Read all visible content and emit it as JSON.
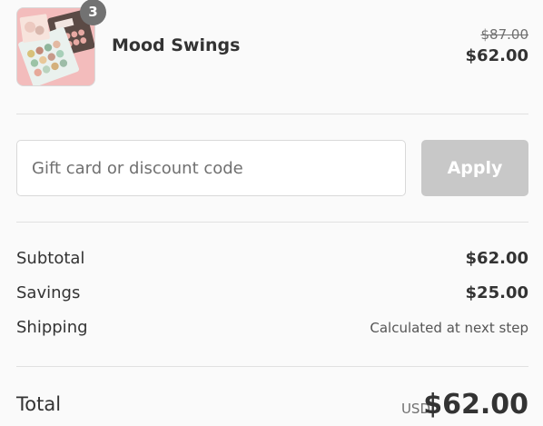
{
  "product": {
    "name": "Mood Swings",
    "quantity": "3",
    "compare_at_price": "$87.00",
    "price": "$62.00",
    "image_icon": "eyeshadow-palette-image"
  },
  "discount": {
    "placeholder": "Gift card or discount code",
    "value": "",
    "apply_label": "Apply"
  },
  "summary": {
    "subtotal_label": "Subtotal",
    "subtotal_value": "$62.00",
    "savings_label": "Savings",
    "savings_value": "$25.00",
    "shipping_label": "Shipping",
    "shipping_value": "Calculated at next step"
  },
  "total": {
    "label": "Total",
    "currency": "USD",
    "amount": "$62.00"
  },
  "colors": {
    "background": "#fafafa",
    "text": "#333333",
    "badge": "#727272",
    "apply_disabled": "#c8c8c8",
    "border": "#d9d9d9"
  }
}
